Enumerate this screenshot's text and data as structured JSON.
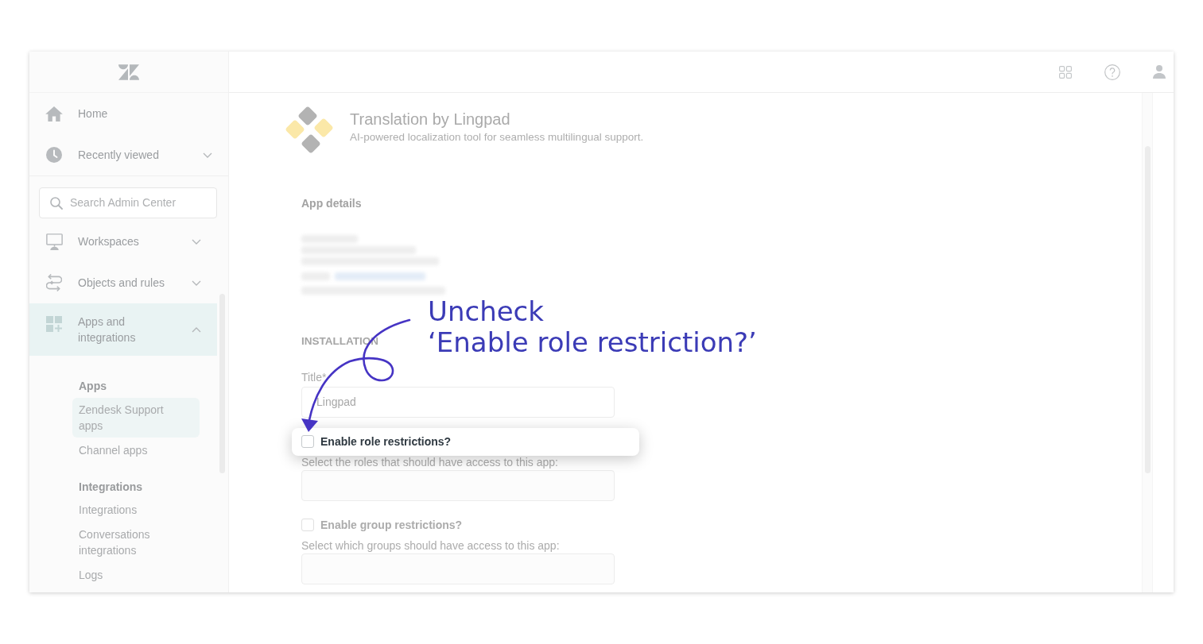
{
  "sidebar": {
    "home": {
      "label": "Home"
    },
    "recently_viewed": {
      "label": "Recently viewed",
      "expanded": false
    },
    "search": {
      "placeholder": "Search Admin Center"
    },
    "nav": [
      {
        "label": "Workspaces",
        "expanded": false,
        "selected": false
      },
      {
        "label": "Objects and rules",
        "expanded": false,
        "selected": false
      },
      {
        "label": "Apps and integrations",
        "expanded": true,
        "selected": true,
        "groups": [
          {
            "heading": "Apps",
            "items": [
              {
                "label": "Zendesk Support apps",
                "selected": true
              },
              {
                "label": "Channel apps",
                "selected": false
              }
            ]
          },
          {
            "heading": "Integrations",
            "items": [
              {
                "label": "Integrations",
                "selected": false
              },
              {
                "label": "Conversations integrations",
                "selected": false
              },
              {
                "label": "Logs",
                "selected": false
              }
            ]
          }
        ]
      }
    ]
  },
  "app": {
    "title": "Translation by Lingpad",
    "description": "AI-powered localization tool for seamless multilingual support."
  },
  "app_details": {
    "heading": "App details"
  },
  "installation": {
    "heading": "INSTALLATION",
    "title_field": {
      "label": "Title*",
      "value": "Lingpad"
    },
    "restrictions": [
      {
        "label": "Enable role restrictions?",
        "checked": false,
        "highlighted": true,
        "hint": "Select the roles that should have access to this app:"
      },
      {
        "label": "Enable group restrictions?",
        "checked": false,
        "highlighted": false,
        "hint": "Select which groups should have access to this app:"
      }
    ]
  },
  "annotation": {
    "lines": [
      "Uncheck",
      "‘Enable role restriction?’"
    ]
  }
}
